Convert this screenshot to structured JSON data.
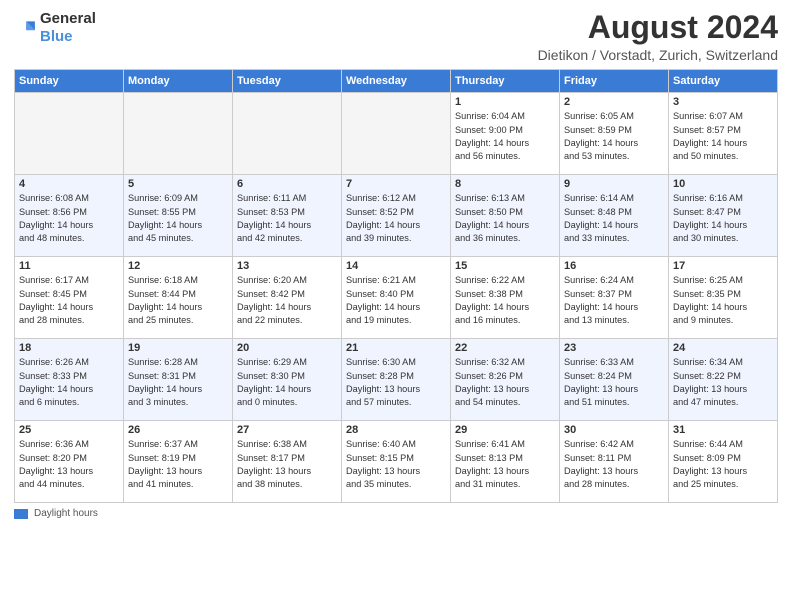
{
  "header": {
    "logo_general": "General",
    "logo_blue": "Blue",
    "title": "August 2024",
    "location": "Dietikon / Vorstadt, Zurich, Switzerland"
  },
  "columns": [
    "Sunday",
    "Monday",
    "Tuesday",
    "Wednesday",
    "Thursday",
    "Friday",
    "Saturday"
  ],
  "weeks": [
    [
      {
        "day": "",
        "info": ""
      },
      {
        "day": "",
        "info": ""
      },
      {
        "day": "",
        "info": ""
      },
      {
        "day": "",
        "info": ""
      },
      {
        "day": "1",
        "info": "Sunrise: 6:04 AM\nSunset: 9:00 PM\nDaylight: 14 hours\nand 56 minutes."
      },
      {
        "day": "2",
        "info": "Sunrise: 6:05 AM\nSunset: 8:59 PM\nDaylight: 14 hours\nand 53 minutes."
      },
      {
        "day": "3",
        "info": "Sunrise: 6:07 AM\nSunset: 8:57 PM\nDaylight: 14 hours\nand 50 minutes."
      }
    ],
    [
      {
        "day": "4",
        "info": "Sunrise: 6:08 AM\nSunset: 8:56 PM\nDaylight: 14 hours\nand 48 minutes."
      },
      {
        "day": "5",
        "info": "Sunrise: 6:09 AM\nSunset: 8:55 PM\nDaylight: 14 hours\nand 45 minutes."
      },
      {
        "day": "6",
        "info": "Sunrise: 6:11 AM\nSunset: 8:53 PM\nDaylight: 14 hours\nand 42 minutes."
      },
      {
        "day": "7",
        "info": "Sunrise: 6:12 AM\nSunset: 8:52 PM\nDaylight: 14 hours\nand 39 minutes."
      },
      {
        "day": "8",
        "info": "Sunrise: 6:13 AM\nSunset: 8:50 PM\nDaylight: 14 hours\nand 36 minutes."
      },
      {
        "day": "9",
        "info": "Sunrise: 6:14 AM\nSunset: 8:48 PM\nDaylight: 14 hours\nand 33 minutes."
      },
      {
        "day": "10",
        "info": "Sunrise: 6:16 AM\nSunset: 8:47 PM\nDaylight: 14 hours\nand 30 minutes."
      }
    ],
    [
      {
        "day": "11",
        "info": "Sunrise: 6:17 AM\nSunset: 8:45 PM\nDaylight: 14 hours\nand 28 minutes."
      },
      {
        "day": "12",
        "info": "Sunrise: 6:18 AM\nSunset: 8:44 PM\nDaylight: 14 hours\nand 25 minutes."
      },
      {
        "day": "13",
        "info": "Sunrise: 6:20 AM\nSunset: 8:42 PM\nDaylight: 14 hours\nand 22 minutes."
      },
      {
        "day": "14",
        "info": "Sunrise: 6:21 AM\nSunset: 8:40 PM\nDaylight: 14 hours\nand 19 minutes."
      },
      {
        "day": "15",
        "info": "Sunrise: 6:22 AM\nSunset: 8:38 PM\nDaylight: 14 hours\nand 16 minutes."
      },
      {
        "day": "16",
        "info": "Sunrise: 6:24 AM\nSunset: 8:37 PM\nDaylight: 14 hours\nand 13 minutes."
      },
      {
        "day": "17",
        "info": "Sunrise: 6:25 AM\nSunset: 8:35 PM\nDaylight: 14 hours\nand 9 minutes."
      }
    ],
    [
      {
        "day": "18",
        "info": "Sunrise: 6:26 AM\nSunset: 8:33 PM\nDaylight: 14 hours\nand 6 minutes."
      },
      {
        "day": "19",
        "info": "Sunrise: 6:28 AM\nSunset: 8:31 PM\nDaylight: 14 hours\nand 3 minutes."
      },
      {
        "day": "20",
        "info": "Sunrise: 6:29 AM\nSunset: 8:30 PM\nDaylight: 14 hours\nand 0 minutes."
      },
      {
        "day": "21",
        "info": "Sunrise: 6:30 AM\nSunset: 8:28 PM\nDaylight: 13 hours\nand 57 minutes."
      },
      {
        "day": "22",
        "info": "Sunrise: 6:32 AM\nSunset: 8:26 PM\nDaylight: 13 hours\nand 54 minutes."
      },
      {
        "day": "23",
        "info": "Sunrise: 6:33 AM\nSunset: 8:24 PM\nDaylight: 13 hours\nand 51 minutes."
      },
      {
        "day": "24",
        "info": "Sunrise: 6:34 AM\nSunset: 8:22 PM\nDaylight: 13 hours\nand 47 minutes."
      }
    ],
    [
      {
        "day": "25",
        "info": "Sunrise: 6:36 AM\nSunset: 8:20 PM\nDaylight: 13 hours\nand 44 minutes."
      },
      {
        "day": "26",
        "info": "Sunrise: 6:37 AM\nSunset: 8:19 PM\nDaylight: 13 hours\nand 41 minutes."
      },
      {
        "day": "27",
        "info": "Sunrise: 6:38 AM\nSunset: 8:17 PM\nDaylight: 13 hours\nand 38 minutes."
      },
      {
        "day": "28",
        "info": "Sunrise: 6:40 AM\nSunset: 8:15 PM\nDaylight: 13 hours\nand 35 minutes."
      },
      {
        "day": "29",
        "info": "Sunrise: 6:41 AM\nSunset: 8:13 PM\nDaylight: 13 hours\nand 31 minutes."
      },
      {
        "day": "30",
        "info": "Sunrise: 6:42 AM\nSunset: 8:11 PM\nDaylight: 13 hours\nand 28 minutes."
      },
      {
        "day": "31",
        "info": "Sunrise: 6:44 AM\nSunset: 8:09 PM\nDaylight: 13 hours\nand 25 minutes."
      }
    ]
  ],
  "legend": {
    "label": "Daylight hours"
  }
}
